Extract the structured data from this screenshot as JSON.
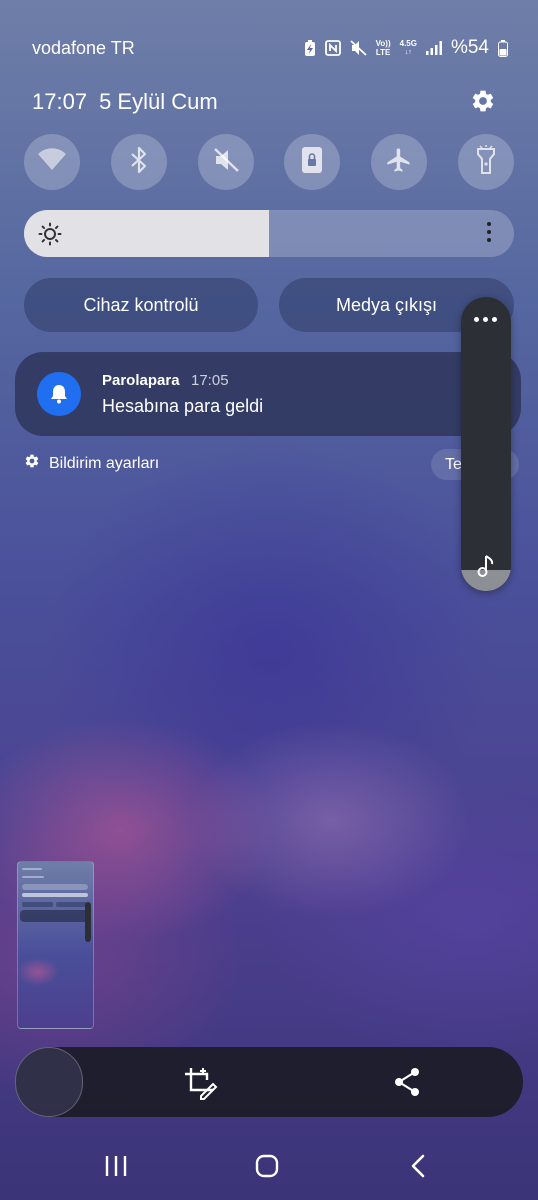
{
  "status_bar": {
    "carrier": "vodafone TR",
    "battery_text": "%54",
    "network_top": "4.5G",
    "volte_label": "Vo))\nLTE",
    "icons": [
      "battery-saver-icon",
      "nfc-icon",
      "mute-icon",
      "volte-icon",
      "network-4.5g-icon",
      "signal-icon",
      "battery-icon"
    ]
  },
  "header": {
    "time": "17:07",
    "date": "5 Eylül Cum"
  },
  "quick_tiles": [
    {
      "name": "wifi",
      "icon": "wifi-icon"
    },
    {
      "name": "bluetooth",
      "icon": "bluetooth-icon"
    },
    {
      "name": "sound",
      "icon": "mute-icon"
    },
    {
      "name": "rotation",
      "icon": "rotation-lock-icon"
    },
    {
      "name": "airplane",
      "icon": "airplane-icon"
    },
    {
      "name": "flashlight",
      "icon": "flashlight-icon"
    }
  ],
  "brightness": {
    "level": 0.5
  },
  "buttons": {
    "device_control": "Cihaz kontrolü",
    "media_output": "Medya çıkışı"
  },
  "notification": {
    "app": "Parolapara",
    "time": "17:05",
    "text": "Hesabına para geldi",
    "icon": "bell-icon",
    "accent": "#1f6ff0"
  },
  "notification_footer": {
    "settings_label": "Bildirim ayarları",
    "clear_label": "Tem"
  },
  "volume_panel": {
    "level": 0.07,
    "icon": "music-note-icon"
  },
  "screenshot_toolbar": {
    "icons": [
      "crop-edit-icon",
      "share-icon"
    ]
  },
  "nav_bar": {
    "icons": [
      "recents-icon",
      "home-icon",
      "back-icon"
    ]
  }
}
